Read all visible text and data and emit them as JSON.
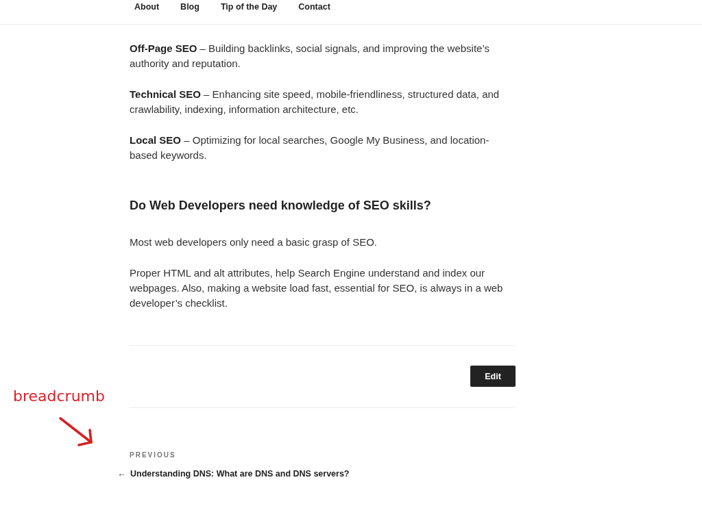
{
  "nav": [
    {
      "label": "About"
    },
    {
      "label": "Blog"
    },
    {
      "label": "Tip of the Day"
    },
    {
      "label": "Contact"
    }
  ],
  "paragraphs_top": [
    "**Off-Page SEO** – Building backlinks, social signals, and improving the website’s authority and reputation.",
    "**Technical SEO** – Enhancing site speed, mobile-friendliness, structured data, and crawlability, indexing, information architecture, etc.",
    "**Local SEO** – Optimizing for local searches, Google My Business, and location-based keywords."
  ],
  "heading": "Do Web Developers need knowledge of SEO skills?",
  "paragraphs_bottom": [
    "Most web developers only need a basic grasp of SEO.",
    "Proper HTML and alt attributes, help Search Engine understand and index our webpages. Also, making a website load fast, essential for SEO, is always in a web developer’s checklist."
  ],
  "edit_button": "Edit",
  "post_nav": {
    "label": "PREVIOUS",
    "arrow": "←",
    "title": "Understanding DNS: What are DNS and DNS servers?"
  },
  "annotation": {
    "text": "breadcrumb"
  }
}
